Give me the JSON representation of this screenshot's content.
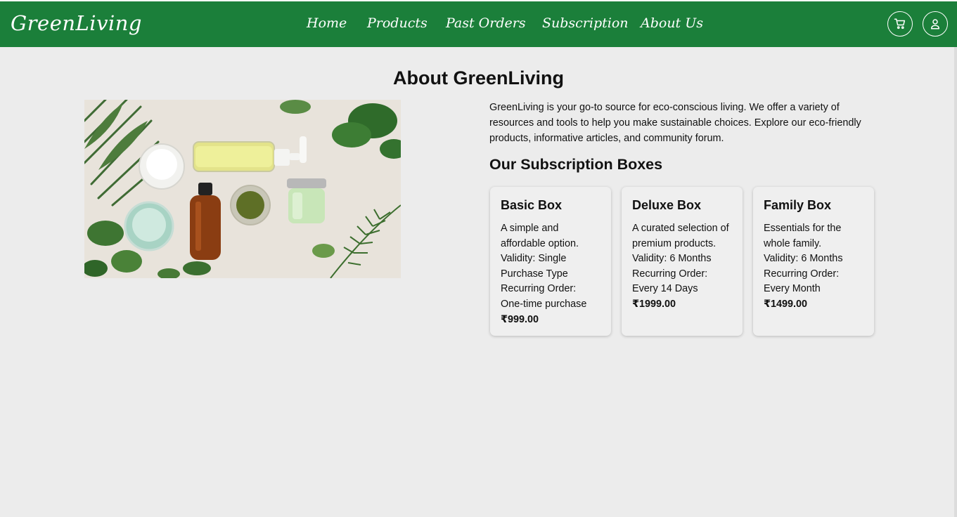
{
  "brand": "GreenLiving",
  "nav": {
    "items": [
      "Home",
      "Products",
      "Past Orders",
      "Subscription",
      "About Us"
    ],
    "cart_icon": "cart-icon",
    "profile_icon": "user-icon"
  },
  "colors": {
    "primary": "#1b7f3a",
    "background": "#ececec"
  },
  "about": {
    "title": "About GreenLiving",
    "description": "GreenLiving is your go-to source for eco-conscious living. We offer a variety of resources and tools to help you make sustainable choices. Explore our eco-friendly products, informative articles, and community forum."
  },
  "subscriptions": {
    "heading": "Our Subscription Boxes",
    "boxes": [
      {
        "name": "Basic Box",
        "description": "A simple and affordable option.",
        "validity": "Validity: Single Purchase Type",
        "recurring": "Recurring Order: One-time purchase",
        "price": "₹999.00"
      },
      {
        "name": "Deluxe Box",
        "description": "A curated selection of premium products.",
        "validity": "Validity: 6 Months",
        "recurring": "Recurring Order: Every 14 Days",
        "price": "₹1999.00"
      },
      {
        "name": "Family Box",
        "description": "Essentials for the whole family.",
        "validity": "Validity: 6 Months",
        "recurring": "Recurring Order: Every Month",
        "price": "₹1499.00"
      }
    ]
  }
}
